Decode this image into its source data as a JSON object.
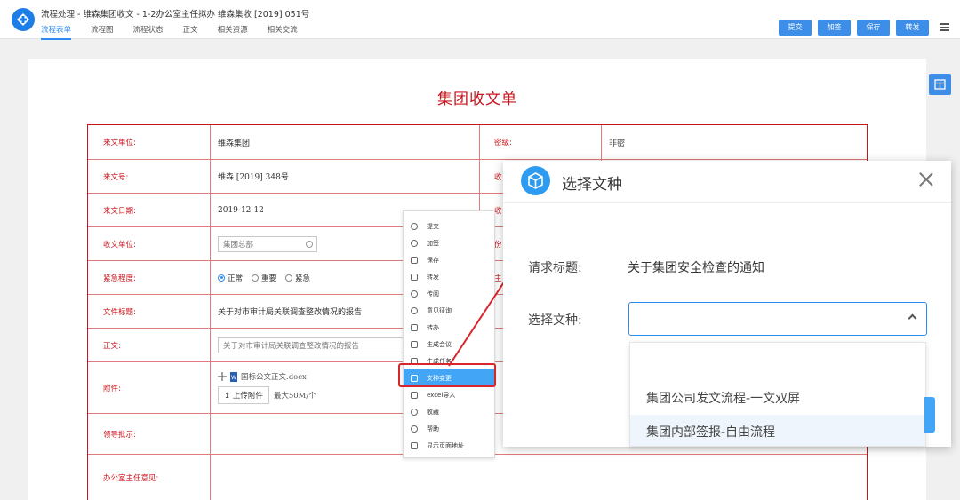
{
  "header": {
    "title": "流程处理 - 维森集团收文 - 1-2办公室主任拟办 维森集收 [2019] 051号",
    "tabs": [
      {
        "label": "流程表单",
        "active": true
      },
      {
        "label": "流程图"
      },
      {
        "label": "流程状态"
      },
      {
        "label": "正文"
      },
      {
        "label": "相关资源"
      },
      {
        "label": "相关交流"
      }
    ],
    "actions": [
      "提交",
      "加签",
      "保存",
      "转发"
    ],
    "menu_icon": "hamburger-menu-icon"
  },
  "form": {
    "title": "集团收文单",
    "rows": [
      {
        "label": "来文单位:",
        "value": "维森集团",
        "label2": "密级:",
        "value2": "非密"
      },
      {
        "label": "来文号:",
        "value": "维森 [2019] 348号",
        "label2": "收"
      },
      {
        "label": "来文日期:",
        "value": "2019-12-12",
        "label2": "收"
      },
      {
        "label": "收文单位:",
        "value": "集团总部",
        "label2": "份"
      },
      {
        "label": "紧急程度:",
        "label2": "主"
      },
      {
        "label": "文件标题:",
        "value": "关于对市审计局关联调查整改情况的报告"
      },
      {
        "label": "正文:",
        "placeholder": "关于对市审计局关联调查整改情况的报告"
      },
      {
        "label": "附件:"
      },
      {
        "label": "领导批示:"
      },
      {
        "label": "办公室主任意见:"
      }
    ],
    "urgency_options": [
      {
        "label": "正常",
        "checked": true
      },
      {
        "label": "重要"
      },
      {
        "label": "紧急"
      }
    ],
    "attachment": {
      "file": "国标公文正文.docx",
      "upload_label": "上传附件",
      "hint": "最大50M/个"
    }
  },
  "context_menu": {
    "items": [
      "提交",
      "加签",
      "保存",
      "转发",
      "传阅",
      "意见征询",
      "转办",
      "生成会议",
      "生成任务",
      "文种变更",
      "excel导入",
      "收藏",
      "帮助",
      "显示页面地址"
    ],
    "selected_index": 9
  },
  "dialog": {
    "title": "选择文种",
    "subject_label": "请求标题:",
    "subject_value": "关于集团安全检查的通知",
    "type_label": "选择文种:",
    "options": [
      "集团公司发文流程-一文双屏",
      "集团内部签报-自由流程"
    ],
    "hover_index": 1
  },
  "colors": {
    "accent": "#2d8cf0",
    "button": "#3d8ee8",
    "form_red": "#c9141c",
    "highlight": "#d9262c"
  }
}
